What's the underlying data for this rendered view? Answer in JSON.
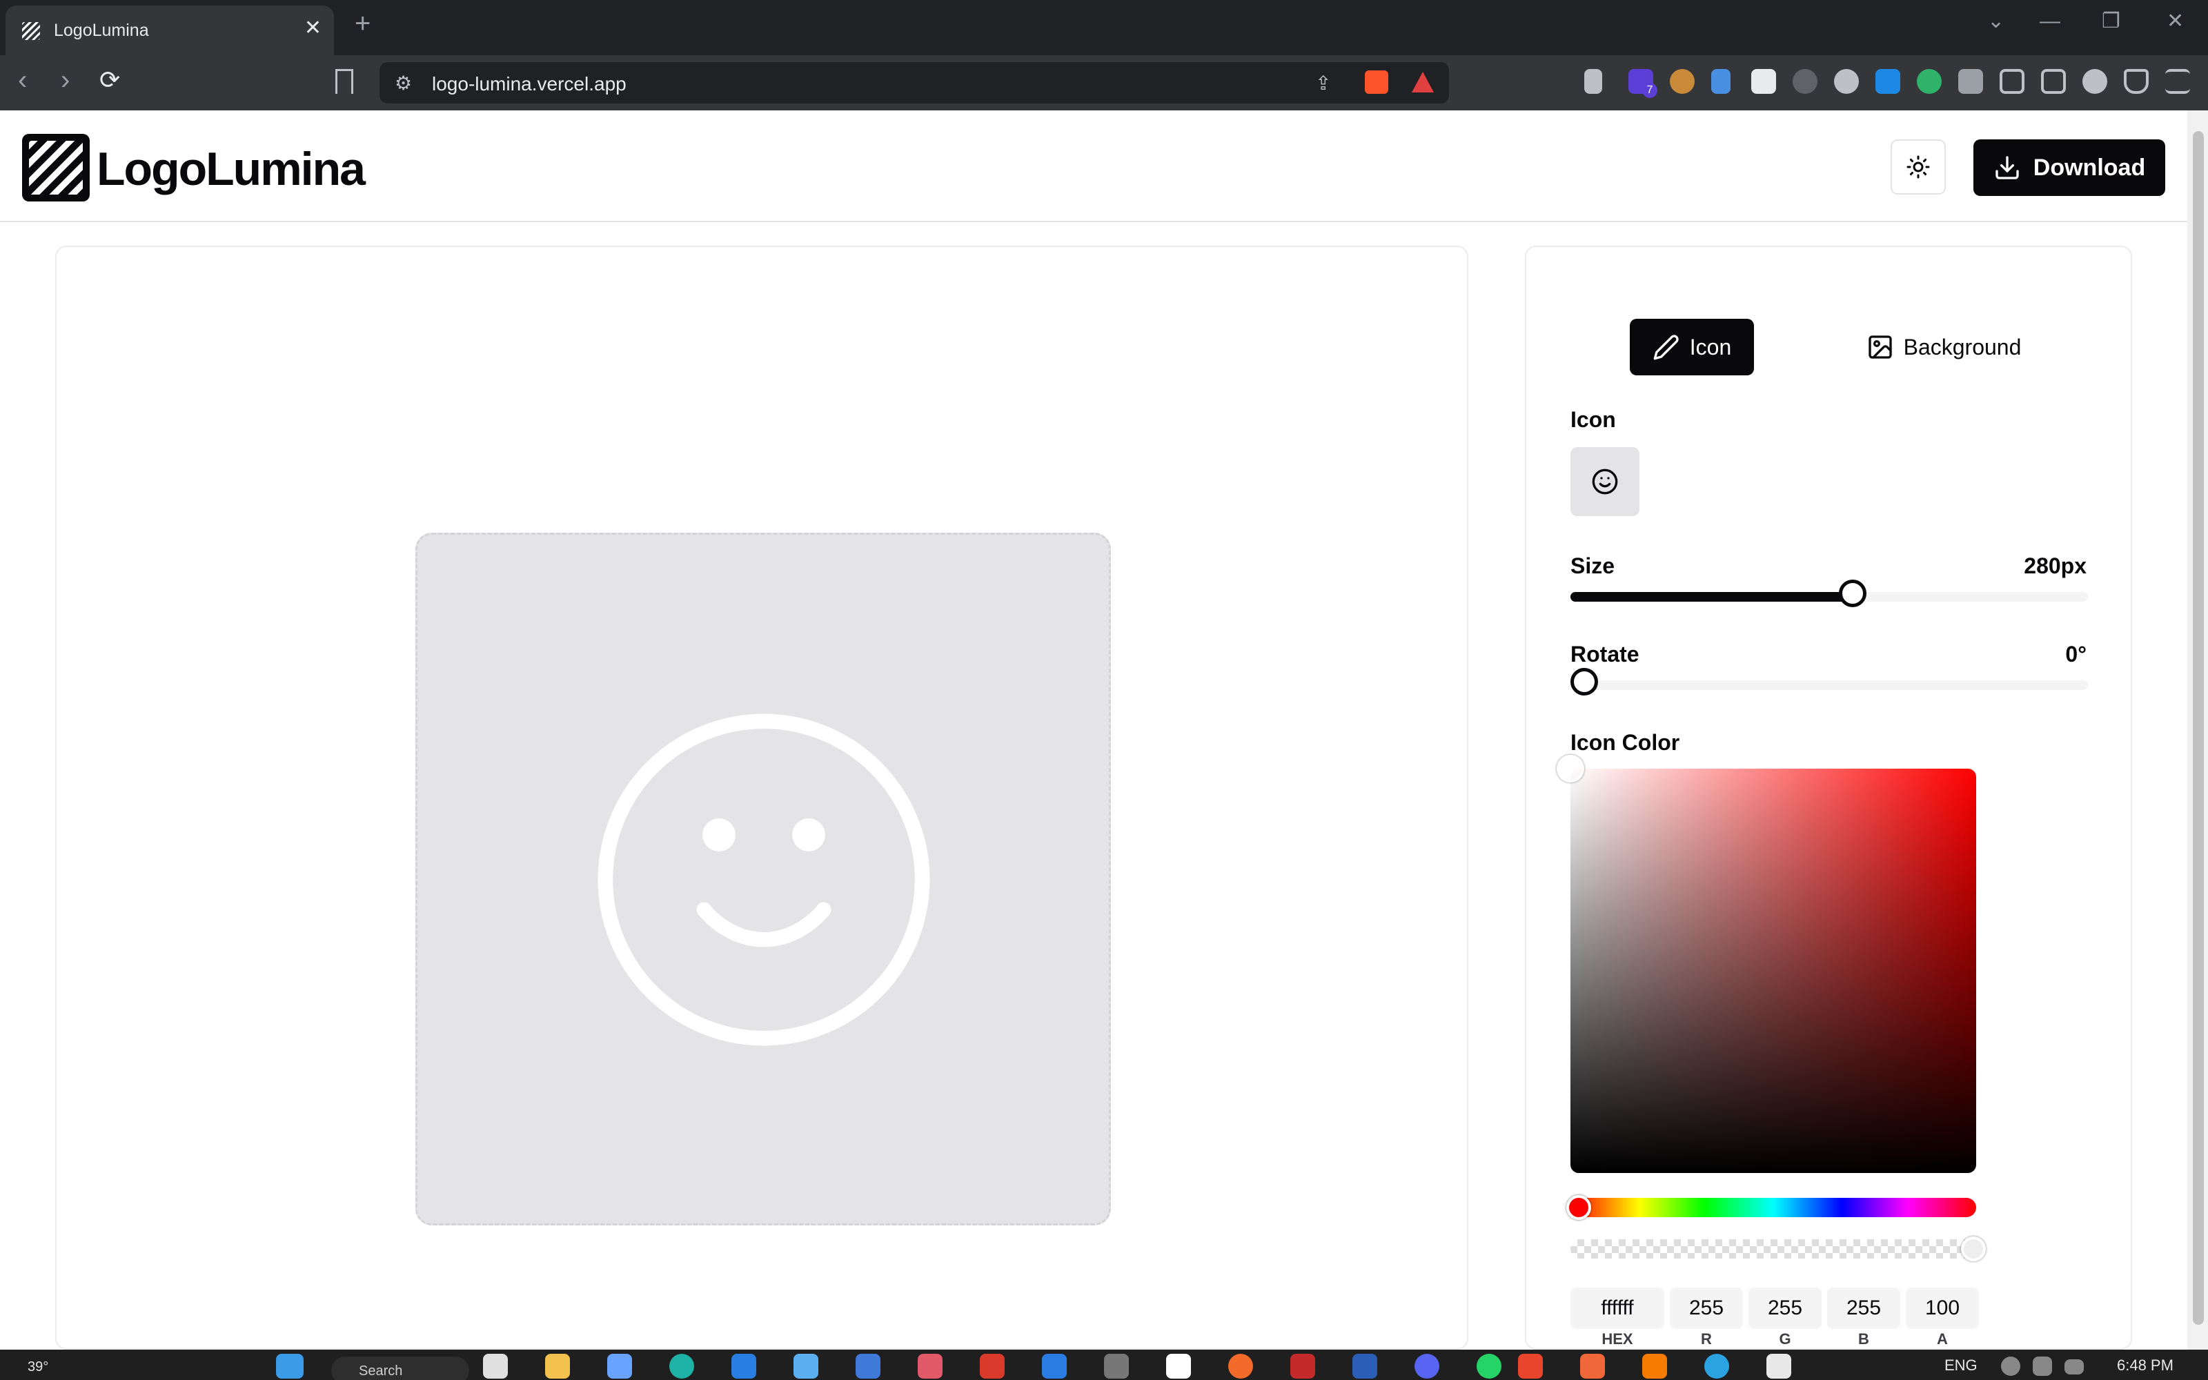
{
  "browser": {
    "tab_title": "LogoLumina",
    "tab_close": "✕",
    "new_tab": "+",
    "url": "logo-lumina.vercel.app",
    "window_controls": {
      "dropdown": "⌄",
      "minimize": "—",
      "restore": "❐",
      "close": "✕"
    },
    "extension_badge": "7"
  },
  "header": {
    "logo_text": "LogoLumina",
    "download_label": "Download"
  },
  "panel": {
    "tabs": [
      {
        "label": "Icon",
        "active": true
      },
      {
        "label": "Background",
        "active": false
      }
    ],
    "icon_section_label": "Icon",
    "selected_icon": "smile-icon",
    "size": {
      "label": "Size",
      "value_text": "280px",
      "fraction": 0.545
    },
    "rotate": {
      "label": "Rotate",
      "value_text": "0°",
      "fraction": 0.0
    },
    "icon_color": {
      "label": "Icon Color",
      "hex": "ffffff",
      "r": "255",
      "g": "255",
      "b": "255",
      "a": "100",
      "field_labels": {
        "hex": "HEX",
        "r": "R",
        "g": "G",
        "b": "B",
        "a": "A"
      }
    }
  },
  "preview": {
    "icon": "smile-icon",
    "icon_color": "#ffffff",
    "background_color": "#e4e4e7"
  },
  "taskbar": {
    "weather": "39°",
    "search_placeholder": "Search",
    "language": "ENG",
    "time": "6:48 PM"
  },
  "colors": {
    "primary": "#09090b",
    "muted": "#f4f4f5",
    "border": "#e4e4e7"
  }
}
